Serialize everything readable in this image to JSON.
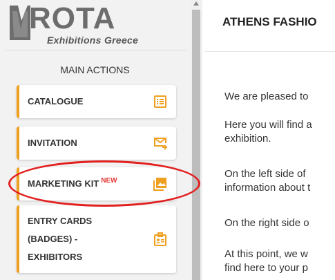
{
  "logo": {
    "text": "ROTA",
    "subtitle": "Exhibitions Greece"
  },
  "sidebar": {
    "section_title": "MAIN ACTIONS",
    "items": [
      {
        "label": "CATALOGUE",
        "icon": "list-icon"
      },
      {
        "label": "INVITATION",
        "icon": "mail-send-icon"
      },
      {
        "label": "MARKETING KIT",
        "badge": "NEW",
        "icon": "image-gallery-icon"
      },
      {
        "label_lines": [
          "ENTRY CARDS",
          "(BADGES) -",
          "EXHIBITORS"
        ],
        "icon": "badge-icon"
      }
    ]
  },
  "main": {
    "title": "ATHENS FASHIO",
    "paragraphs": [
      {
        "lines": [
          "We are pleased to"
        ]
      },
      {
        "lines": [
          "Here you will find a",
          "exhibition."
        ]
      },
      {
        "lines": [
          "On the left side of",
          "information about t"
        ]
      },
      {
        "lines": [
          "On the right side o"
        ]
      },
      {
        "lines": [
          "At this point, we w",
          "find here to your p"
        ]
      }
    ]
  },
  "colors": {
    "accent": "#f0a020",
    "badge": "#e53935",
    "annotation": "#e32020"
  }
}
